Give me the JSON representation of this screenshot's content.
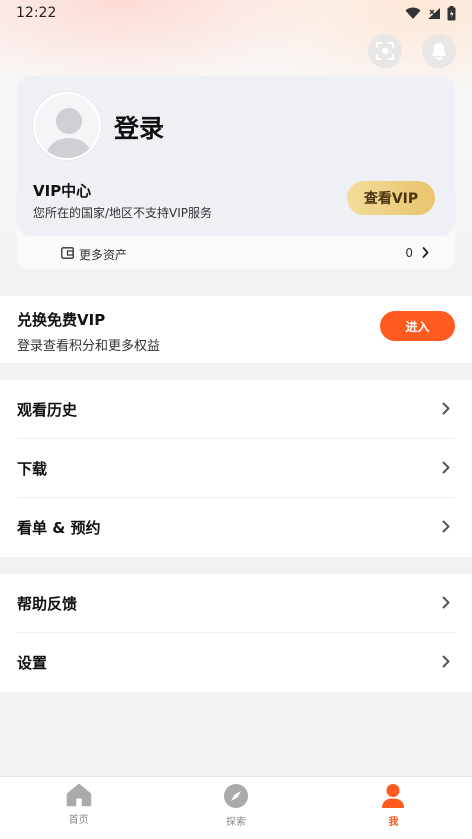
{
  "status_bar": {
    "time": "12:22"
  },
  "profile": {
    "login_label": "登录",
    "vip_title": "VIP中心",
    "vip_notice": "您所在的国家/地区不支持VIP服务",
    "vip_button": "查看VIP",
    "assets_label": "更多资产",
    "assets_count": "0"
  },
  "redeem": {
    "title": "兑换免费VIP",
    "subtitle": "登录查看积分和更多权益",
    "button": "进入"
  },
  "menu_primary": [
    {
      "label": "观看历史"
    },
    {
      "label": "下载"
    },
    {
      "label": "看单 & 预约"
    }
  ],
  "menu_secondary": [
    {
      "label": "帮助反馈"
    },
    {
      "label": "设置"
    }
  ],
  "tabbar": {
    "tabs": [
      {
        "label": "首页",
        "icon": "home-icon"
      },
      {
        "label": "探索",
        "icon": "compass-icon"
      },
      {
        "label": "我",
        "icon": "person-icon"
      }
    ],
    "active_index": 2
  },
  "colors": {
    "accent": "#ff5a1f",
    "vip_gold_start": "#f3dd99",
    "vip_gold_end": "#e8c46c",
    "vip_card_bg": "#efeff6",
    "page_bg": "#f2f2f2"
  }
}
